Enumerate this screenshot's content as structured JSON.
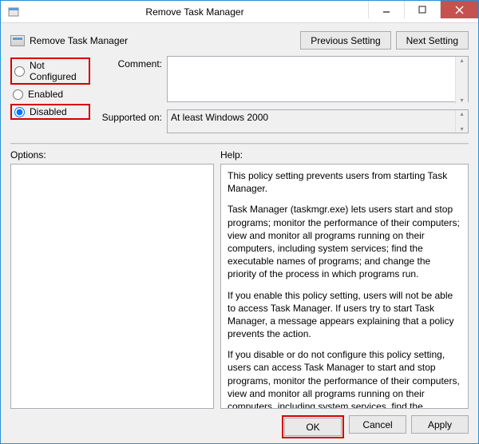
{
  "window": {
    "title": "Remove Task Manager"
  },
  "header": {
    "policy_name": "Remove Task Manager",
    "prev": "Previous Setting",
    "next": "Next Setting"
  },
  "radios": {
    "not_configured": "Not Configured",
    "enabled": "Enabled",
    "disabled": "Disabled"
  },
  "fields": {
    "comment_label": "Comment:",
    "comment_value": "",
    "supported_label": "Supported on:",
    "supported_value": "At least Windows 2000"
  },
  "labels": {
    "options": "Options:",
    "help": "Help:"
  },
  "help": {
    "p1": "This policy setting prevents users from starting Task Manager.",
    "p2": "Task Manager (taskmgr.exe) lets users start and stop programs; monitor the performance of their computers; view and monitor all programs running on their computers, including system services; find the executable names of programs; and change the priority of the process in which programs run.",
    "p3": "If you enable this policy setting, users will not be able to access Task Manager. If users try to start Task Manager, a message appears explaining that a policy prevents the action.",
    "p4": "If you disable or do not configure this policy setting, users can access Task Manager to  start and stop programs, monitor the performance of their computers, view and monitor all programs running on their computers, including system services, find the executable names of programs, and change the priority of the process in which programs run."
  },
  "footer": {
    "ok": "OK",
    "cancel": "Cancel",
    "apply": "Apply"
  }
}
